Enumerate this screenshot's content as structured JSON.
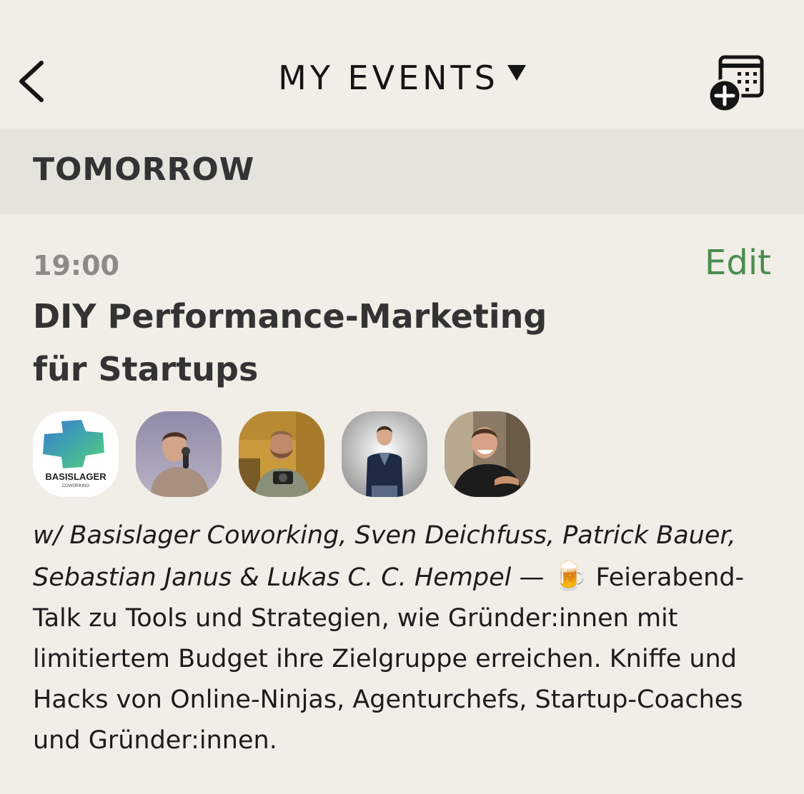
{
  "header": {
    "title": "MY EVENTS",
    "back_icon": "chevron-left-icon",
    "dropdown_icon": "caret-down-icon",
    "add_calendar_icon": "calendar-add-icon"
  },
  "section": {
    "title": "TOMORROW"
  },
  "event": {
    "time": "19:00",
    "edit_label": "Edit",
    "title_line1": "DIY Performance-Marketing",
    "title_line2": "für Startups",
    "hosts": [
      {
        "name": "Basislager Coworking",
        "logo_text": "BASISLAGER",
        "logo_subtext": "COWORKING"
      },
      {
        "name": "Sven Deichfuss"
      },
      {
        "name": "Patrick Bauer"
      },
      {
        "name": "Sebastian Janus"
      },
      {
        "name": "Lukas C. C. Hempel"
      }
    ],
    "with_line": "w/ Basislager Coworking, Sven Deichfuss, Patrick Bauer, Sebastian Janus & Lukas C. C. Hempel",
    "separator": " — ",
    "emoji": "🍺",
    "description": "Feierabend-Talk zu Tools und Strategien, wie Gründer:innen mit limitiertem Budget ihre Zielgruppe erreichen. Kniffe und Hacks von Online-Ninjas, Agenturchefs, Startup-Coaches und Gründer:innen."
  },
  "colors": {
    "background": "#f0eee6",
    "section_bg": "#e4e4dc",
    "accent_green": "#4a8d4f",
    "time_gray": "#8b8b87",
    "text_dark": "#333333"
  }
}
